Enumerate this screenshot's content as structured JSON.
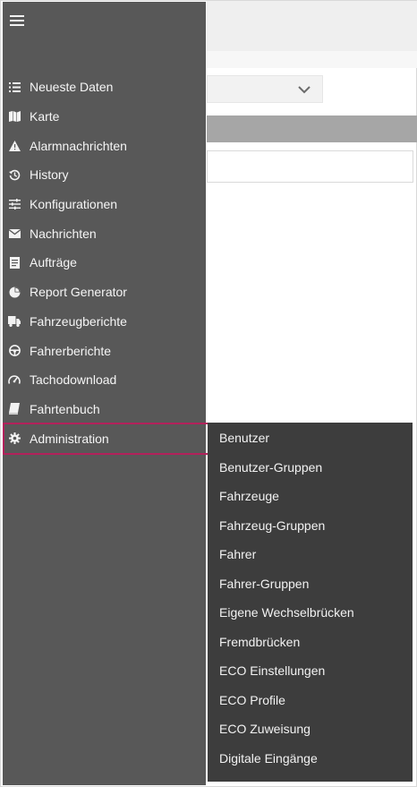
{
  "nav": {
    "toggle_icon": "hamburger-icon",
    "items": [
      {
        "label": "Neueste Daten",
        "icon": "list-icon"
      },
      {
        "label": "Karte",
        "icon": "map-icon"
      },
      {
        "label": "Alarmnachrichten",
        "icon": "warning-icon"
      },
      {
        "label": "History",
        "icon": "history-icon"
      },
      {
        "label": "Konfigurationen",
        "icon": "sliders-icon"
      },
      {
        "label": "Nachrichten",
        "icon": "envelope-icon"
      },
      {
        "label": "Aufträge",
        "icon": "document-icon"
      },
      {
        "label": "Report Generator",
        "icon": "pie-chart-icon"
      },
      {
        "label": "Fahrzeugberichte",
        "icon": "truck-icon"
      },
      {
        "label": "Fahrerberichte",
        "icon": "steering-wheel-icon"
      },
      {
        "label": "Tachodownload",
        "icon": "tachometer-icon"
      },
      {
        "label": "Fahrtenbuch",
        "icon": "book-icon"
      },
      {
        "label": "Administration",
        "icon": "gear-icon"
      }
    ]
  },
  "submenu": {
    "items": [
      "Benutzer",
      "Benutzer-Gruppen",
      "Fahrzeuge",
      "Fahrzeug-Gruppen",
      "Fahrer",
      "Fahrer-Gruppen",
      "Eigene Wechselbrücken",
      "Fremdbrücken",
      "ECO Einstellungen",
      "ECO Profile",
      "ECO Zuweisung",
      "Digitale Eingänge"
    ]
  },
  "colors": {
    "sidebar_bg": "#585858",
    "submenu_bg": "#3d3d3d",
    "highlight_border": "#b3215b",
    "text": "#f5f5f5"
  }
}
